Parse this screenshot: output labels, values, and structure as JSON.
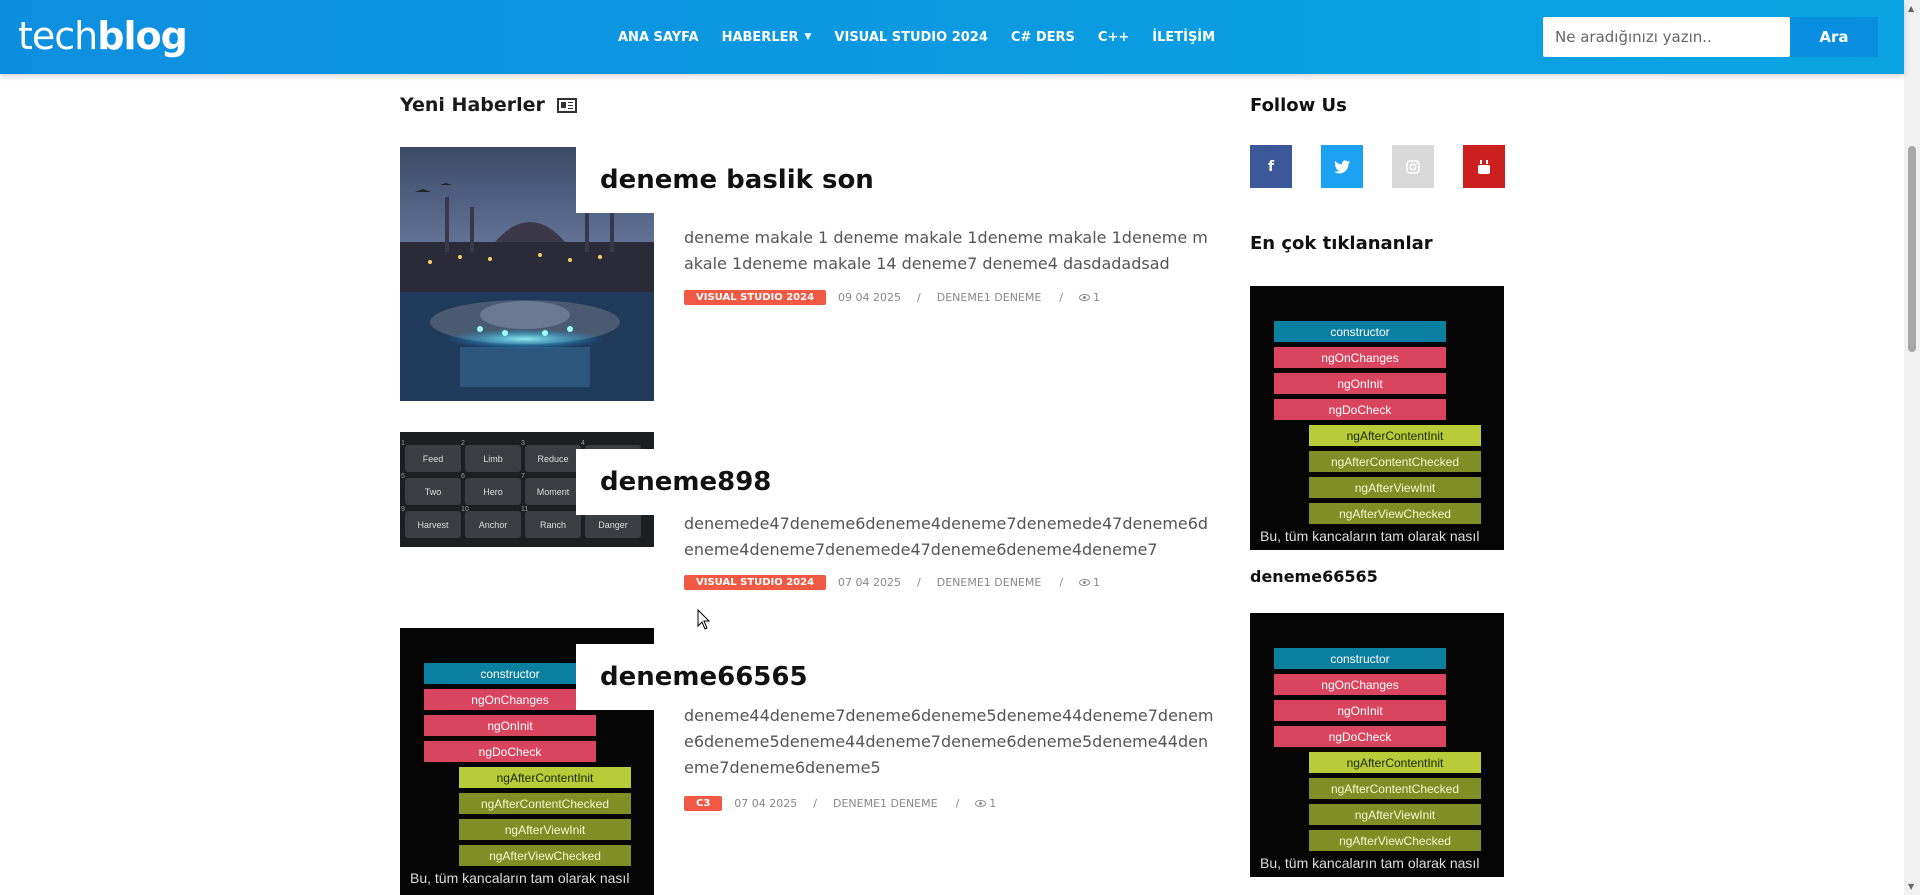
{
  "header": {
    "logo_light": "tech",
    "logo_bold": "blog",
    "nav": [
      {
        "label": "ANA SAYFA",
        "has_caret": false
      },
      {
        "label": "HABERLER",
        "has_caret": true
      },
      {
        "label": "VISUAL STUDIO 2024",
        "has_caret": false
      },
      {
        "label": "C# DERS",
        "has_caret": false
      },
      {
        "label": "C++",
        "has_caret": false
      },
      {
        "label": "İLETİŞİM",
        "has_caret": false
      }
    ],
    "search_placeholder": "Ne aradığınızı yazın..",
    "search_button": "Ara"
  },
  "main": {
    "section_title": "Yeni Haberler",
    "articles": [
      {
        "title": "deneme baslik son",
        "excerpt": "deneme makale 1 deneme makale 1deneme makale 1deneme makale 1deneme makale 14 deneme7 deneme4 dasdadadsad",
        "category": "VISUAL STUDIO 2024",
        "date": "09 04 2025",
        "separator": "/",
        "author": "DENEME1 DENEME",
        "views": "1",
        "image": "istanbul-ufo"
      },
      {
        "title": "deneme898",
        "excerpt": "denemede47deneme6deneme4deneme7denemede47deneme6deneme4deneme7denemede47deneme6deneme4deneme7",
        "category": "VISUAL STUDIO 2024",
        "date": "07 04 2025",
        "separator": "/",
        "author": "DENEME1 DENEME",
        "views": "1",
        "image": "keyboard-grid"
      },
      {
        "title": "deneme66565",
        "excerpt": "deneme44deneme7deneme6deneme5deneme44deneme7deneme6deneme5deneme44deneme7deneme6deneme5deneme44deneme7deneme6deneme5",
        "category": "C3",
        "date": "07 04 2025",
        "separator": "/",
        "author": "DENEME1 DENEME",
        "views": "1",
        "image": "angular-lifecycle"
      }
    ]
  },
  "keyboard_keys": [
    {
      "n": "1",
      "label": "Feed"
    },
    {
      "n": "2",
      "label": "Limb"
    },
    {
      "n": "3",
      "label": "Reduce"
    },
    {
      "n": "4",
      "label": ""
    },
    {
      "n": "5",
      "label": "Two"
    },
    {
      "n": "6",
      "label": "Hero"
    },
    {
      "n": "7",
      "label": "Moment"
    },
    {
      "n": "8",
      "label": ""
    },
    {
      "n": "9",
      "label": "Harvest"
    },
    {
      "n": "10",
      "label": "Anchor"
    },
    {
      "n": "11",
      "label": "Ranch"
    },
    {
      "n": "12",
      "label": "Danger"
    }
  ],
  "lifecycle": {
    "hooks": [
      "constructor",
      "ngOnChanges",
      "ngOnInit",
      "ngDoCheck",
      "ngAfterContentInit",
      "ngAfterContentChecked",
      "ngAfterViewInit",
      "ngAfterViewChecked"
    ],
    "caption": "Bu, tüm kancaların tam olarak nasıl"
  },
  "sidebar": {
    "follow_title": "Follow Us",
    "social": [
      {
        "name": "facebook",
        "glyph": "f",
        "color": "#3b5998"
      },
      {
        "name": "twitter",
        "glyph": "t",
        "color": "#1da1f2"
      },
      {
        "name": "instagram",
        "glyph": "◎",
        "color": "#d9d9d9"
      },
      {
        "name": "youtube",
        "glyph": "▶",
        "color": "#cc1f1f"
      }
    ],
    "popular_title": "En çok tıklananlar",
    "popular_item_title": "deneme66565"
  },
  "colors": {
    "header_start": "#0d8fe0",
    "header_end": "#0aa4e2",
    "badge": "#f05a45"
  }
}
